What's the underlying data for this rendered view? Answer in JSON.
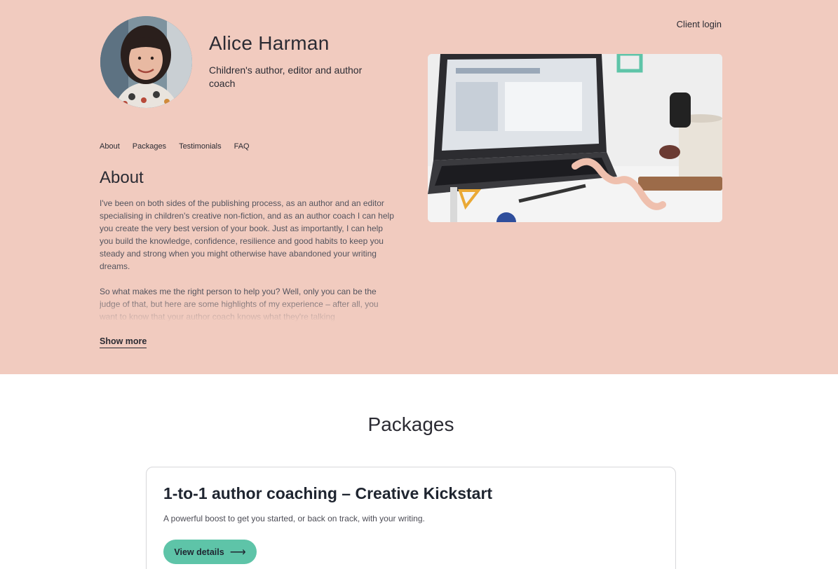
{
  "header": {
    "name": "Alice Harman",
    "tagline": "Children's author, editor and author coach",
    "client_login": "Client login"
  },
  "nav": {
    "items": [
      "About",
      "Packages",
      "Testimonials",
      "FAQ"
    ]
  },
  "about": {
    "title": "About",
    "paragraph1": "I've been on both sides of the publishing process, as an author and an editor specialising in children's creative non-fiction, and as an author coach I can help you create the very best version of your book. Just as importantly, I can help you build the knowledge, confidence, resilience and good habits to keep you steady and strong when you might otherwise have abandoned your writing dreams.",
    "paragraph2": "So what makes me the right person to help you? Well, only you can be the judge of that, but here are some highlights of my experience – after all, you want to know that your author coach knows what they're talking",
    "show_more": "Show more"
  },
  "packages": {
    "title": "Packages",
    "card": {
      "title": "1-to-1 author coaching – Creative Kickstart",
      "description": "A powerful boost to get you started, or back on track, with your writing.",
      "button": "View details",
      "button_icon": "arrow-right-icon"
    }
  },
  "colors": {
    "hero_bg": "#f1cbbf",
    "accent": "#5ec4a8",
    "text": "#2b2b33"
  }
}
